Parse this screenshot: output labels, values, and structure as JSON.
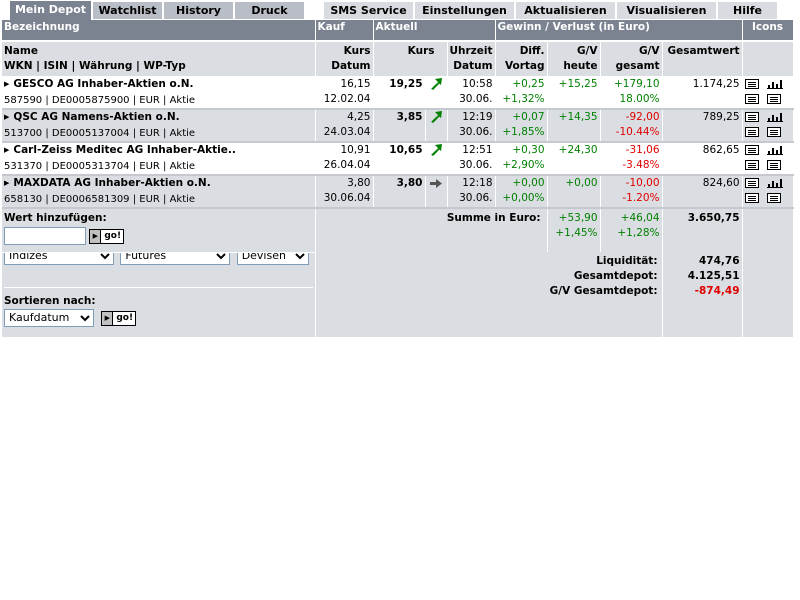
{
  "tabs_left": [
    {
      "label": "Mein Depot",
      "active": true
    },
    {
      "label": "Watchlist",
      "active": false
    },
    {
      "label": "History",
      "active": false
    },
    {
      "label": "Druck",
      "active": false
    }
  ],
  "tabs_right": [
    {
      "label": "SMS Service"
    },
    {
      "label": "Einstellungen"
    },
    {
      "label": "Aktualisieren"
    },
    {
      "label": "Visualisieren"
    },
    {
      "label": "Hilfe"
    }
  ],
  "header": {
    "bezeichnung": "Bezeichnung",
    "kauf": "Kauf",
    "aktuell": "Aktuell",
    "gewinn": "Gewinn / Verlust  (in Euro)",
    "icons": "Icons"
  },
  "subheader": {
    "name": "Name",
    "wkn": "WKN | ISIN | Währung | WP-Typ",
    "kurs_datum_1": "Kurs",
    "kurs_datum_2": "Datum",
    "kurs": "Kurs",
    "uhrzeit_1": "Uhrzeit",
    "uhrzeit_2": "Datum",
    "diff_1": "Diff.",
    "diff_2": "Vortag",
    "gv_heute_1": "G/V",
    "gv_heute_2": "heute",
    "gv_gesamt_1": "G/V",
    "gv_gesamt_2": "gesamt",
    "gesamtwert": "Gesamtwert"
  },
  "stocks": [
    {
      "name": "GESCO AG Inhaber-Aktien o.N.",
      "info": "587590 | DE0005875900 | EUR | Aktie",
      "kauf_kurs": "16,15",
      "kauf_datum": "12.02.04",
      "kurs": "19,25",
      "trend": "up",
      "zeit": "10:58",
      "datum": "30.06.",
      "diff": "+0,25",
      "diff_pct": "+1,32%",
      "gv_heute": "+15,25",
      "gv_gesamt": "+179,10",
      "gv_gesamt_pct": "18.00%",
      "gesamtwert": "1.174,25",
      "sign": "pos"
    },
    {
      "name": "QSC AG Namens-Aktien o.N.",
      "info": "513700 | DE0005137004 | EUR | Aktie",
      "kauf_kurs": "4,25",
      "kauf_datum": "24.03.04",
      "kurs": "3,85",
      "trend": "up",
      "zeit": "12:19",
      "datum": "30.06.",
      "diff": "+0,07",
      "diff_pct": "+1,85%",
      "gv_heute": "+14,35",
      "gv_gesamt": "-92,00",
      "gv_gesamt_pct": "-10.44%",
      "gesamtwert": "789,25",
      "sign": "neg"
    },
    {
      "name": "Carl-Zeiss Meditec AG Inhaber-Aktie..",
      "info": "531370 | DE0005313704 | EUR | Aktie",
      "kauf_kurs": "10,91",
      "kauf_datum": "26.04.04",
      "kurs": "10,65",
      "trend": "up",
      "zeit": "12:51",
      "datum": "30.06.",
      "diff": "+0,30",
      "diff_pct": "+2,90%",
      "gv_heute": "+24,30",
      "gv_gesamt": "-31,06",
      "gv_gesamt_pct": "-3.48%",
      "gesamtwert": "862,65",
      "sign": "neg"
    },
    {
      "name": "MAXDATA AG Inhaber-Aktien o.N.",
      "info": "658130 | DE0006581309 | EUR | Aktie",
      "kauf_kurs": "3,80",
      "kauf_datum": "30.06.04",
      "kurs": "3,80",
      "trend": "flat",
      "zeit": "12:18",
      "datum": "30.06.",
      "diff": "+0,00",
      "diff_pct": "+0,00%",
      "gv_heute": "+0,00",
      "gv_gesamt": "-10,00",
      "gv_gesamt_pct": "-1.20%",
      "gesamtwert": "824,60",
      "sign": "neg"
    }
  ],
  "add": {
    "label": "Wert hinzufügen:",
    "input_value": "",
    "go_label": "go!",
    "select_1": "Indizes",
    "select_2": "Futures",
    "select_3": "Devisen"
  },
  "summe": {
    "label": "Summe in Euro:",
    "gv_heute": "+53,90",
    "gv_heute_pct": "+1,45%",
    "gv_gesamt": "+46,04",
    "gv_gesamt_pct": "+1,28%",
    "gesamtwert": "3.650,75"
  },
  "liquid": {
    "liquiditaet_label": "Liquidität:",
    "liquiditaet": "474,76",
    "gesamtdepot_label": "Gesamtdepot:",
    "gesamtdepot": "4.125,51",
    "gv_label": "G/V Gesamtdepot:",
    "gv": "-874,49"
  },
  "sort": {
    "label": "Sortieren nach:",
    "select": "Kaufdatum",
    "go_label": "go!"
  },
  "colors": {
    "tab_active": "#7b8390",
    "tab_inactive": "#b9bec6",
    "row_gray": "#dadde1",
    "positive": "#008000",
    "negative": "#e00000"
  }
}
